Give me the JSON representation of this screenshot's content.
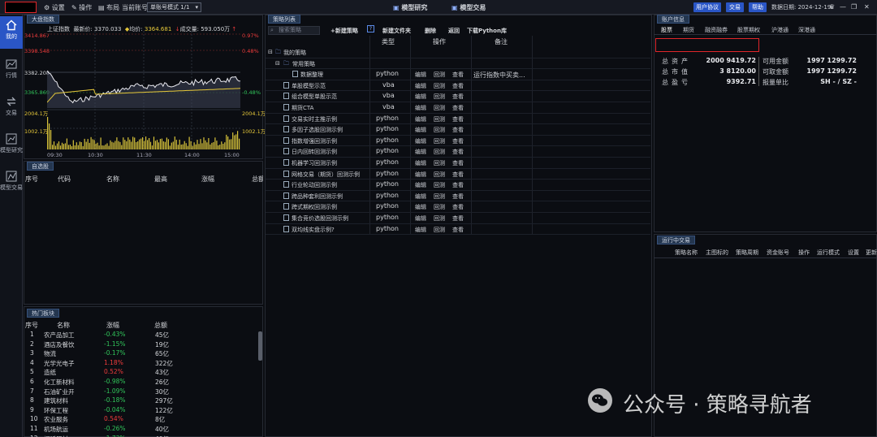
{
  "topbar": {
    "settings_label": "设置",
    "operate_label": "操作",
    "layout_label": "布局",
    "current_account_label": "当前账号",
    "account_mode_value": "单账号模式 1/1",
    "tab_model_research": "模型研究",
    "tab_model_trading": "模型交易",
    "user_protocol": "用户协议",
    "trade_button": "交易",
    "help_button": "帮助",
    "data_date_label": "数据日期",
    "data_date_value": "2024-12-19"
  },
  "leftnav": {
    "items": [
      {
        "label": "我的",
        "icon": "home-icon"
      },
      {
        "label": "行情",
        "icon": "chart-icon"
      },
      {
        "label": "交易",
        "icon": "trade-icon"
      },
      {
        "label": "模型研究",
        "icon": "model-research-icon"
      },
      {
        "label": "模型交易",
        "icon": "model-trade-icon"
      }
    ]
  },
  "market": {
    "panel_title": "大盘指数",
    "index_name": "上证指数",
    "latest_label": "最新价",
    "latest_value": "3370.033",
    "avg_label": "均价",
    "avg_value": "3364.681",
    "volume_label": "成交量",
    "volume_value": "593.050万",
    "y_left": [
      "3414.867",
      "3398.548",
      "3382.208",
      "3365.869"
    ],
    "y_right": [
      "0.97%",
      "0.48%",
      "0",
      "-0.48%"
    ],
    "vol_labels": [
      "2004.1万",
      "1002.1万"
    ],
    "x_labels": [
      "09:30",
      "10:30",
      "11:30",
      "14:00",
      "15:00"
    ]
  },
  "watchlist": {
    "panel_title": "自选股",
    "columns": [
      "序号",
      "代码",
      "名称",
      "最高",
      "涨幅",
      "总额"
    ]
  },
  "hot": {
    "panel_title": "热门板块",
    "columns": [
      "序号",
      "名称",
      "涨幅",
      "总额"
    ],
    "rows": [
      {
        "no": "1",
        "name": "农产品加工",
        "chg": "-0.43%",
        "amt": "45亿",
        "dir": "down"
      },
      {
        "no": "2",
        "name": "酒店及餐饮",
        "chg": "-1.15%",
        "amt": "19亿",
        "dir": "down"
      },
      {
        "no": "3",
        "name": "物流",
        "chg": "-0.17%",
        "amt": "65亿",
        "dir": "down"
      },
      {
        "no": "4",
        "name": "光学光电子",
        "chg": "1.18%",
        "amt": "322亿",
        "dir": "up"
      },
      {
        "no": "5",
        "name": "造纸",
        "chg": "0.52%",
        "amt": "43亿",
        "dir": "up"
      },
      {
        "no": "6",
        "name": "化工新材料",
        "chg": "-0.98%",
        "amt": "26亿",
        "dir": "down"
      },
      {
        "no": "7",
        "name": "石油矿业开",
        "chg": "-1.09%",
        "amt": "30亿",
        "dir": "down"
      },
      {
        "no": "8",
        "name": "建筑材料",
        "chg": "-0.18%",
        "amt": "297亿",
        "dir": "down"
      },
      {
        "no": "9",
        "name": "环保工程",
        "chg": "-0.04%",
        "amt": "122亿",
        "dir": "down"
      },
      {
        "no": "10",
        "name": "农业服务",
        "chg": "0.54%",
        "amt": "8亿",
        "dir": "up"
      },
      {
        "no": "11",
        "name": "机场航运",
        "chg": "-0.26%",
        "amt": "40亿",
        "dir": "down"
      },
      {
        "no": "12",
        "name": "视听器材",
        "chg": "-1.73%",
        "amt": "40亿",
        "dir": "down"
      }
    ]
  },
  "strategies": {
    "panel_title": "策略列表",
    "search_placeholder": "搜索策略",
    "toolbar": [
      "+新建策略",
      "新建文件夹",
      "删除",
      "返回",
      "下载Python库"
    ],
    "columns": {
      "type": "类型",
      "action": "操作",
      "note": "备注"
    },
    "folder_root": "我的策略",
    "folder_common": "常用策略",
    "actions": [
      "编辑",
      "回测",
      "查看"
    ],
    "rows": [
      {
        "name": "数据整理",
        "type": "python",
        "note": "运行指数中买卖..."
      },
      {
        "name": "单股模型示范",
        "type": "vba",
        "note": ""
      },
      {
        "name": "组合模型单股示范",
        "type": "vba",
        "note": ""
      },
      {
        "name": "期货CTA",
        "type": "vba",
        "note": ""
      },
      {
        "name": "交易实时主推示例",
        "type": "python",
        "note": ""
      },
      {
        "name": "多因子选股回测示例",
        "type": "python",
        "note": ""
      },
      {
        "name": "指数增强回测示例",
        "type": "python",
        "note": ""
      },
      {
        "name": "日内回转回测示例",
        "type": "python",
        "note": ""
      },
      {
        "name": "机器学习回测示例",
        "type": "python",
        "note": ""
      },
      {
        "name": "网格交易（期货）回测示例",
        "type": "python",
        "note": ""
      },
      {
        "name": "行业轮动回测示例",
        "type": "python",
        "note": ""
      },
      {
        "name": "跨品种套利回测示例",
        "type": "python",
        "note": ""
      },
      {
        "name": "跨式期权回测示例",
        "type": "python",
        "note": ""
      },
      {
        "name": "集合竞价选股回测示例",
        "type": "python",
        "note": ""
      },
      {
        "name": "双均线实盘示例?",
        "type": "python",
        "note": ""
      }
    ]
  },
  "account": {
    "panel_title": "账户信息",
    "tabs": [
      "股票",
      "期货",
      "融资融券",
      "股票期权",
      "沪港通",
      "深港通"
    ],
    "total_assets_label": "总资产",
    "total_assets_value": "2000 9419.72",
    "market_value_label": "总市值",
    "market_value_value": "3 8120.00",
    "profit_label": "总盈亏",
    "profit_value": "9392.71",
    "available_label": "可用金额",
    "available_value": "1997 1299.72",
    "withdrawable_label": "可取金额",
    "withdrawable_value": "1997 1299.72",
    "order_unit_label": "报量单比",
    "order_unit_value": "SH - / SZ -"
  },
  "running": {
    "panel_title": "运行中交易",
    "columns": [
      "策略名称",
      "主图标的",
      "策略周期",
      "资金账号",
      "操作",
      "运行模式",
      "设置",
      "更新"
    ]
  },
  "watermark": "公众号 · 策略寻航者",
  "colors": {
    "accent": "#2a56c6",
    "up": "#f03c3c",
    "down": "#31c55a",
    "panel_title": "#24364f"
  }
}
